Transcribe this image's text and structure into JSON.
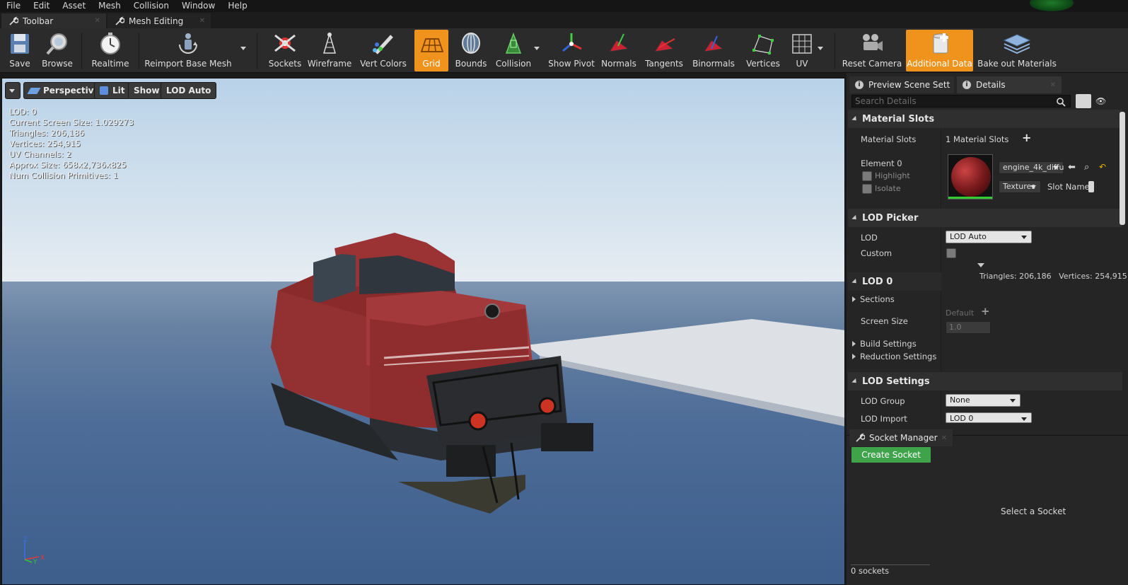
{
  "menu": [
    "File",
    "Edit",
    "Asset",
    "Mesh",
    "Collision",
    "Window",
    "Help"
  ],
  "tabs": [
    {
      "label": "Toolbar"
    },
    {
      "label": "Mesh Editing"
    }
  ],
  "toolbar": {
    "save": "Save",
    "browse": "Browse",
    "realtime": "Realtime",
    "reimport": "Reimport Base Mesh",
    "sockets": "Sockets",
    "wireframe": "Wireframe",
    "vert_colors": "Vert Colors",
    "grid": "Grid",
    "bounds": "Bounds",
    "collision": "Collision",
    "show_pivot": "Show Pivot",
    "normals": "Normals",
    "tangents": "Tangents",
    "binormals": "Binormals",
    "vertices": "Vertices",
    "uv": "UV",
    "reset_camera": "Reset Camera",
    "additional_data": "Additional Data",
    "bake_out_materials": "Bake out Materials",
    "active_color": "#f0931c"
  },
  "viewport": {
    "perspective": "Perspective",
    "lit": "Lit",
    "show": "Show",
    "lod_auto": "LOD Auto",
    "stats": [
      "LOD:  0",
      "Current Screen Size:  1.029273",
      "Triangles:  206,186",
      "Vertices:  254,915",
      "UV Channels:  2",
      "Approx Size: 658x2,736x825",
      "Num Collision Primitives:  1"
    ],
    "axis_z": "Z",
    "axis_y": "Y",
    "axis_x": "X"
  },
  "panels": {
    "preview_scene_tab": "Preview Scene Sett",
    "details_tab": "Details",
    "search_placeholder": "Search Details"
  },
  "details": {
    "material_slots_header": "Material Slots",
    "material_slots_label": "Material Slots",
    "material_slots_value": "1 Material Slots",
    "element0": "Element 0",
    "highlight": "Highlight",
    "isolate": "Isolate",
    "material_name": "engine_4k_diffu",
    "textures": "Textures",
    "slot_name": "Slot Name",
    "lod_picker_header": "LOD Picker",
    "lod_label": "LOD",
    "lod_value": "LOD Auto",
    "custom_label": "Custom",
    "triangles_info": "Triangles: 206,186",
    "vertices_info": "Vertices: 254,915",
    "lod0_header": "LOD 0",
    "sections": "Sections",
    "default_label": "Default",
    "screen_size_label": "Screen Size",
    "screen_size_value": "1.0",
    "build_settings": "Build Settings",
    "reduction_settings": "Reduction Settings",
    "lod_settings_header": "LOD Settings",
    "lod_group_label": "LOD Group",
    "lod_group_value": "None",
    "lod_import_label": "LOD Import",
    "lod_import_value": "LOD 0"
  },
  "socket_manager": {
    "title": "Socket Manager",
    "create_socket": "Create Socket",
    "select_socket": "Select a Socket",
    "sockets_count": "0 sockets"
  }
}
